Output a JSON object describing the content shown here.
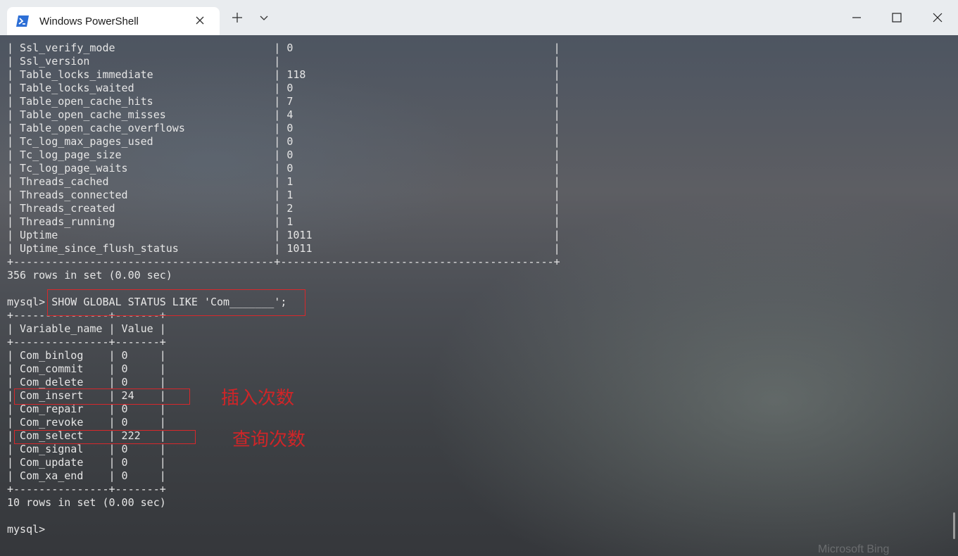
{
  "window": {
    "tab_title": "Windows PowerShell",
    "icons": {
      "tab_icon": "powershell-icon",
      "tab_close": "close-icon",
      "new_tab": "plus-icon",
      "dropdown": "chevron-down-icon",
      "minimize": "minimize-icon",
      "maximize": "maximize-icon",
      "close": "close-icon"
    }
  },
  "terminal": {
    "lines": [
      "| Ssl_verify_mode                         | 0                                         |",
      "| Ssl_version                             |                                           |",
      "| Table_locks_immediate                   | 118                                       |",
      "| Table_locks_waited                      | 0                                         |",
      "| Table_open_cache_hits                   | 7                                         |",
      "| Table_open_cache_misses                 | 4                                         |",
      "| Table_open_cache_overflows              | 0                                         |",
      "| Tc_log_max_pages_used                   | 0                                         |",
      "| Tc_log_page_size                        | 0                                         |",
      "| Tc_log_page_waits                       | 0                                         |",
      "| Threads_cached                          | 1                                         |",
      "| Threads_connected                       | 1                                         |",
      "| Threads_created                         | 2                                         |",
      "| Threads_running                         | 1                                         |",
      "| Uptime                                  | 1011                                      |",
      "| Uptime_since_flush_status               | 1011                                      |",
      "+-----------------------------------------+-------------------------------------------+",
      "356 rows in set (0.00 sec)",
      "",
      "mysql> SHOW GLOBAL STATUS LIKE 'Com_______';",
      "+---------------+-------+",
      "| Variable_name | Value |",
      "+---------------+-------+",
      "| Com_binlog    | 0     |",
      "| Com_commit    | 0     |",
      "| Com_delete    | 0     |",
      "| Com_insert    | 24    |",
      "| Com_repair    | 0     |",
      "| Com_revoke    | 0     |",
      "| Com_select    | 222   |",
      "| Com_signal    | 0     |",
      "| Com_update    | 0     |",
      "| Com_xa_end    | 0     |",
      "+---------------+-------+",
      "10 rows in set (0.00 sec)",
      "",
      "mysql> "
    ],
    "annotations": {
      "insert_label": "插入次数",
      "select_label": "查询次数"
    },
    "watermark": "Microsoft Bing",
    "highlight_color": "#d8282b"
  }
}
